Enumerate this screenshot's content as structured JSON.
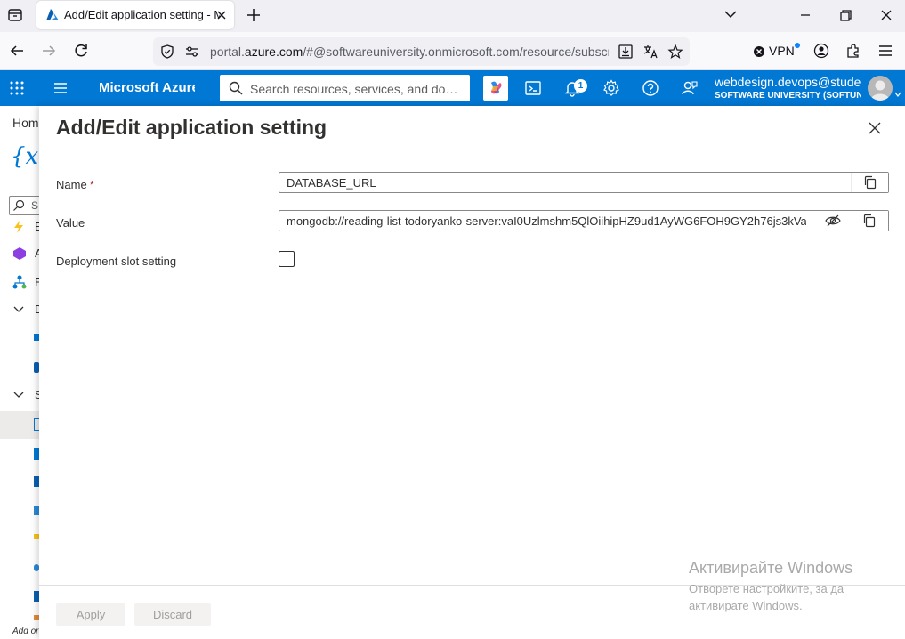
{
  "browser": {
    "tab_title": "Add/Edit application setting - Microsoft Azure",
    "url_prefix": "portal.",
    "url_domain": "azure.com",
    "url_rest": "/#@softwareuniversity.onmicrosoft.com/resource/subscriptions",
    "vpn_label": "VPN"
  },
  "azure": {
    "brand": "Microsoft Azure",
    "search_placeholder": "Search resources, services, and docs (G+/)",
    "notification_count": "1",
    "user_email": "webdesign.devops@students.softuni.bg",
    "user_directory": "SOFTWARE UNIVERSITY (SOFTUNI.ONMICROSOFT.COM)"
  },
  "background_page": {
    "breadcrumb_home": "Home",
    "icon_glyph": "{x}",
    "search_letter": "S",
    "rows": [
      "E",
      "A",
      "F",
      "D",
      "S"
    ],
    "footer": "Add or"
  },
  "panel": {
    "title": "Add/Edit application setting",
    "name_label": "Name",
    "required_mark": "*",
    "name_value": "DATABASE_URL",
    "value_label": "Value",
    "value_value": "mongodb://reading-list-todoryanko-server:vaI0Uzlmshm5QlOiihipHZ9ud1AyWG6FOH9GY2h76js3kVa",
    "deployment_label": "Deployment slot setting",
    "deployment_checked": false,
    "apply_label": "Apply",
    "discard_label": "Discard"
  },
  "watermark": {
    "title": "Активирайте Windows",
    "line1": "Отворете настройките, за да",
    "line2": "активирате Windows."
  },
  "colors": {
    "azure_blue": "#0078d4",
    "required_red": "#a4262c",
    "tab_bg": "#f0f0f4"
  }
}
